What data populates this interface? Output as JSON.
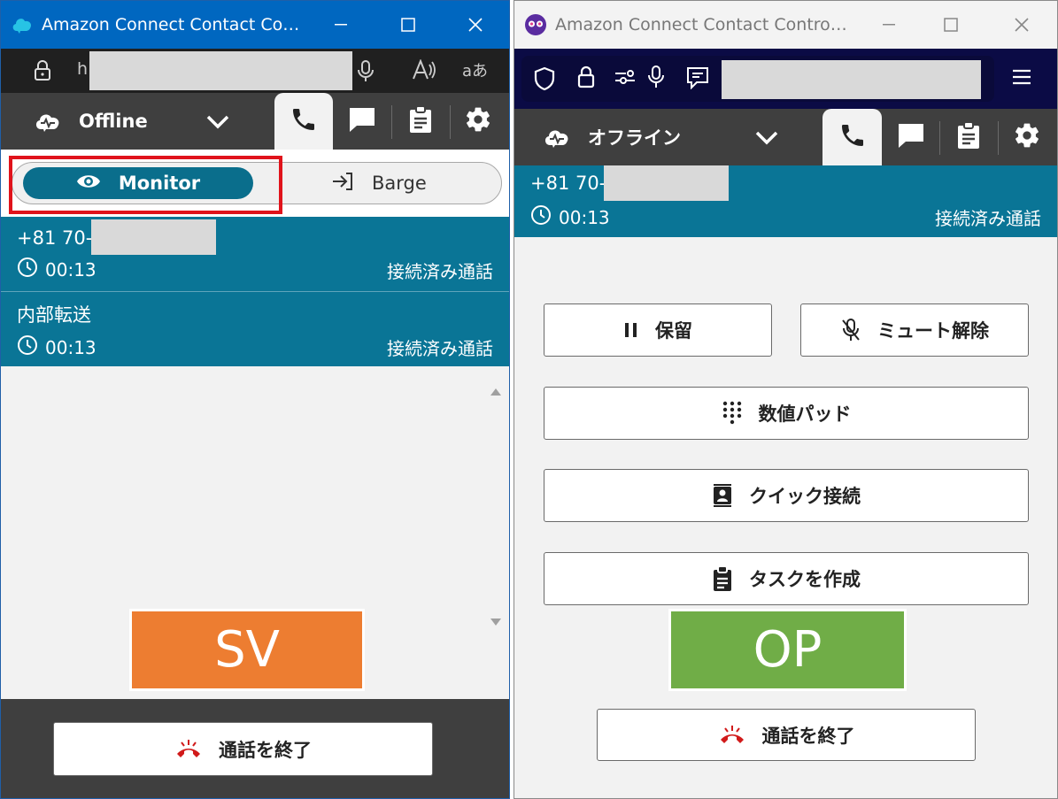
{
  "left_window": {
    "title": "Amazon Connect Contact Contr...",
    "url_prefix": "h",
    "status_label": "Offline",
    "monitor_label": "Monitor",
    "barge_label": "Barge",
    "contacts": [
      {
        "number": "+81 70-",
        "timer": "00:13",
        "state": "接続済み通話"
      },
      {
        "number": "内部転送",
        "timer": "00:13",
        "state": "接続済み通話"
      }
    ],
    "overlay_label": "SV",
    "overlay_color": "#ed7d31",
    "end_call_label": "通話を終了"
  },
  "right_window": {
    "title": "Amazon Connect Contact Control Pa...",
    "status_label": "オフライン",
    "contact": {
      "number": "+81 70-",
      "timer": "00:13",
      "state": "接続済み通話"
    },
    "actions": {
      "hold_label": "保留",
      "unmute_label": "ミュート解除",
      "keypad_label": "数値パッド",
      "quick_connect_label": "クイック接続",
      "create_task_label": "タスクを作成"
    },
    "overlay_label": "OP",
    "overlay_color": "#70ad47",
    "end_call_label": "通話を終了"
  },
  "colors": {
    "contact_bg": "#0a7596",
    "header_bg": "#3f3f3f",
    "highlight": "#e0131b",
    "end_call_icon": "#d11a1a"
  }
}
